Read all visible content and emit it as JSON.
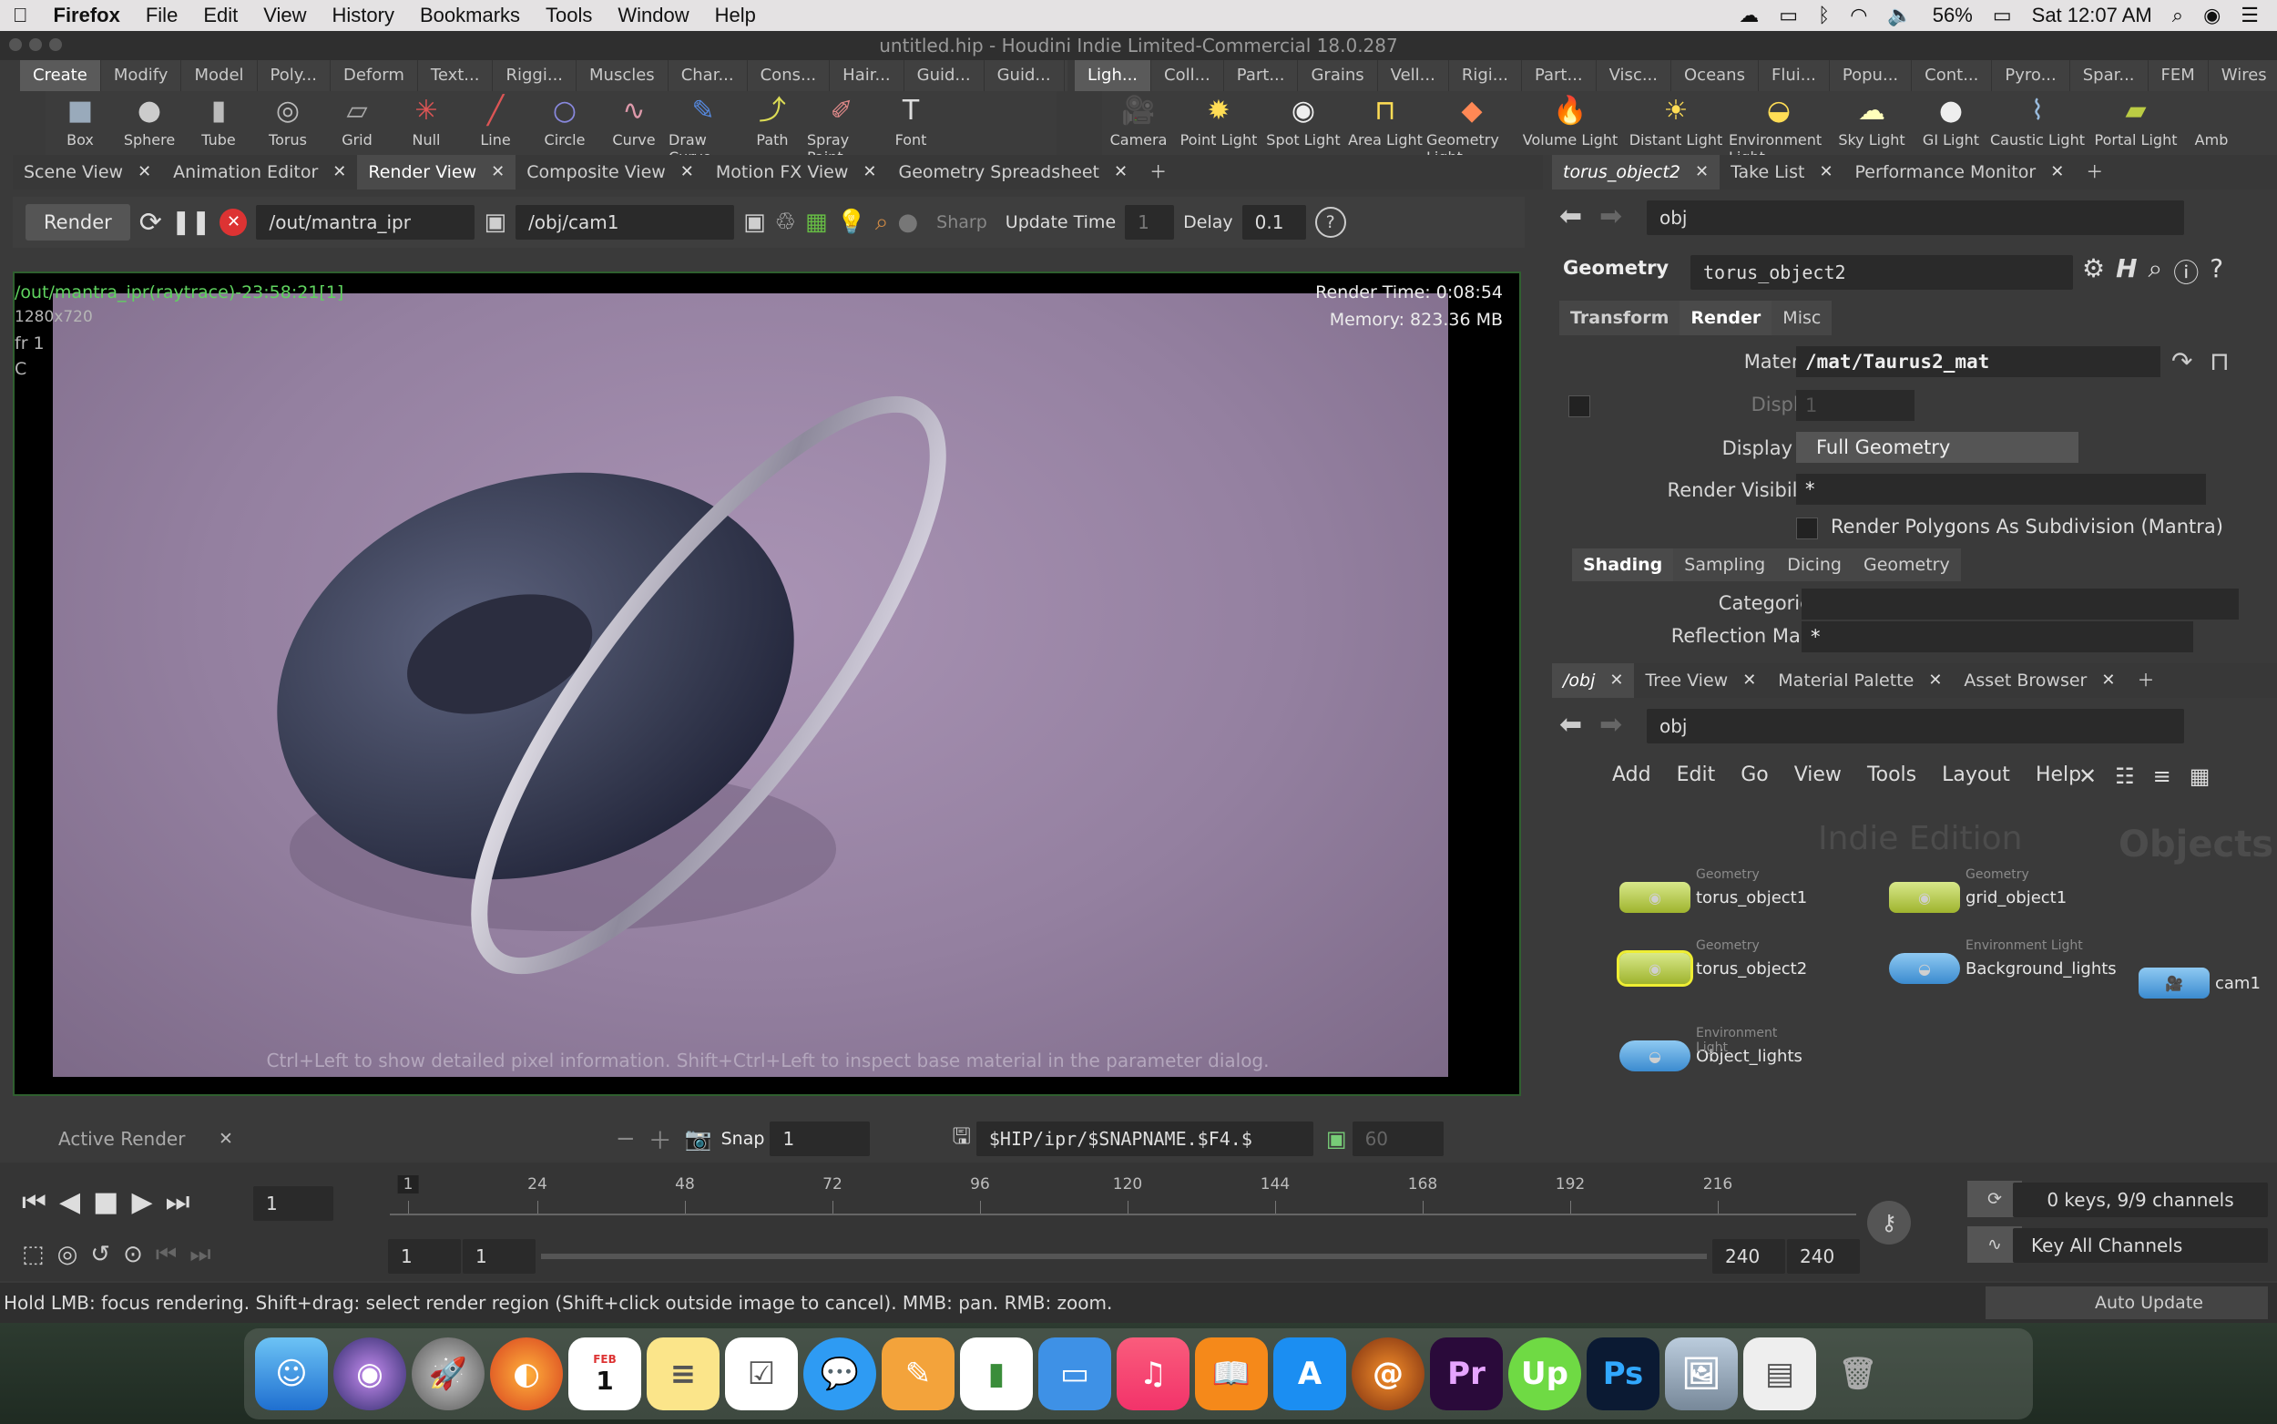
{
  "menubar": {
    "app": "Firefox",
    "items": [
      "File",
      "Edit",
      "View",
      "History",
      "Bookmarks",
      "Tools",
      "Window",
      "Help"
    ],
    "battery": "56%",
    "clock": "Sat 12:07 AM"
  },
  "window_title": "untitled.hip - Houdini Indie Limited-Commercial 18.0.287",
  "shelf_left": {
    "tabs": [
      "Create",
      "Modify",
      "Model",
      "Poly...",
      "Deform",
      "Text...",
      "Riggi...",
      "Muscles",
      "Char...",
      "Cons...",
      "Hair...",
      "Guid...",
      "Guid..."
    ],
    "tools": [
      "Box",
      "Sphere",
      "Tube",
      "Torus",
      "Grid",
      "Null",
      "Line",
      "Circle",
      "Curve",
      "Draw Curve",
      "Path",
      "Spray Paint",
      "Font"
    ]
  },
  "shelf_right": {
    "tabs": [
      "Ligh...",
      "Coll...",
      "Part...",
      "Grains",
      "Vell...",
      "Rigi...",
      "Part...",
      "Visc...",
      "Oceans",
      "Flui...",
      "Popu...",
      "Cont...",
      "Pyro...",
      "Spar...",
      "FEM",
      "Wires"
    ],
    "tools": [
      "Camera",
      "Point Light",
      "Spot Light",
      "Area Light",
      "Geometry Light",
      "Volume Light",
      "Distant Light",
      "Environment Light",
      "Sky Light",
      "GI Light",
      "Caustic Light",
      "Portal Light",
      "Amb"
    ]
  },
  "left_pane_tabs": [
    "Scene View",
    "Animation Editor",
    "Render View",
    "Composite View",
    "Motion FX View",
    "Geometry Spreadsheet"
  ],
  "render_toolbar": {
    "render_button": "Render",
    "output_path": "/out/mantra_ipr",
    "camera_path": "/obj/cam1",
    "sharp_label": "Sharp",
    "update_time_label": "Update Time",
    "update_time_value": "1",
    "delay_label": "Delay",
    "delay_value": "0.1"
  },
  "render_overlay": {
    "render_name": "/out/mantra_ipr(raytrace)-23:58:21[1]",
    "resolution": "1280x720",
    "frame": "fr 1",
    "channel": "C",
    "render_time": "Render Time: 0:08:54",
    "memory": "Memory:   823.36 MB",
    "hint": "Ctrl+Left to show detailed pixel information. Shift+Ctrl+Left to inspect base material in the parameter dialog."
  },
  "render_bottom": {
    "active_render": "Active Render",
    "snap_label": "Snap",
    "snap_value": "1",
    "snapshot_path": "$HIP/ipr/$SNAPNAME.$F4.$",
    "count": "60"
  },
  "timeline": {
    "current_frame": "1",
    "ticks": [
      "24",
      "48",
      "72",
      "96",
      "120",
      "144",
      "168",
      "192",
      "216"
    ],
    "range_start": "1",
    "range_start2": "1",
    "range_end": "240",
    "range_end2": "240",
    "keys_info": "0 keys, 9/9 channels",
    "key_all": "Key All Channels",
    "auto_update": "Auto Update"
  },
  "status_text": "Hold LMB: focus rendering. Shift+drag: select render region (Shift+click outside image to cancel). MMB: pan. RMB: zoom.",
  "param_pane": {
    "tabs": [
      "torus_object2",
      "Take List",
      "Performance Monitor"
    ],
    "path": "obj",
    "node_type": "Geometry",
    "node_name": "torus_object2",
    "sub_tabs": [
      "Transform",
      "Render",
      "Misc"
    ],
    "params": {
      "material_label": "Material",
      "material_value": "/mat/Taurus2_mat",
      "display_label": "Display",
      "display_value": "1",
      "display_as_label": "Display As",
      "display_as_value": "Full Geometry",
      "render_visibility_label": "Render Visibility",
      "render_visibility_value": "*",
      "subdivision_label": "Render Polygons As Subdivision (Mantra)"
    },
    "shading_tabs": [
      "Shading",
      "Sampling",
      "Dicing",
      "Geometry"
    ],
    "categories_label": "Categories",
    "reflection_mask_label": "Reflection Mask",
    "reflection_mask_value": "*"
  },
  "network_pane": {
    "tabs": [
      "/obj",
      "Tree View",
      "Material Palette",
      "Asset Browser"
    ],
    "path": "obj",
    "menu": [
      "Add",
      "Edit",
      "Go",
      "View",
      "Tools",
      "Layout",
      "Help"
    ],
    "watermark_edition": "Indie Edition",
    "watermark_context": "Objects",
    "nodes": [
      {
        "type": "Geometry",
        "name": "torus_object1"
      },
      {
        "type": "Geometry",
        "name": "grid_object1"
      },
      {
        "type": "Geometry",
        "name": "torus_object2"
      },
      {
        "type": "Environment Light",
        "name": "Background_lights"
      },
      {
        "type": "",
        "name": "cam1"
      },
      {
        "type": "Environment Light",
        "name": "Object_lights"
      }
    ]
  },
  "dock": {
    "calendar_month": "FEB",
    "calendar_day": "1",
    "premiere": "Pr",
    "upwork": "Up",
    "photoshop": "Ps"
  },
  "colors": {
    "accent_green": "#5fd35f",
    "render_bg": "#9a86a5",
    "node_yellow": "#c7d65a"
  }
}
